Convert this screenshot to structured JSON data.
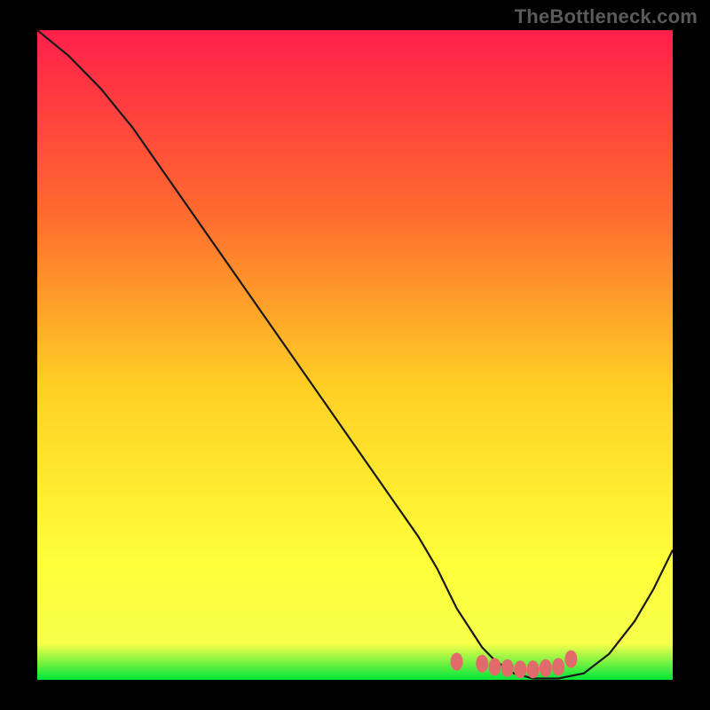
{
  "attribution": "TheBottleneck.com",
  "chart_data": {
    "type": "line",
    "title": "",
    "xlabel": "",
    "ylabel": "",
    "xlim": [
      0,
      100
    ],
    "ylim": [
      0,
      100
    ],
    "series": [
      {
        "name": "curve",
        "x": [
          0,
          5,
          10,
          15,
          20,
          25,
          30,
          35,
          40,
          45,
          50,
          55,
          60,
          63,
          66,
          70,
          72,
          75,
          78,
          82,
          86,
          90,
          94,
          97,
          100
        ],
        "y": [
          100,
          96,
          91,
          85,
          78,
          71,
          64,
          57,
          50,
          43,
          36,
          29,
          22,
          17,
          11,
          5,
          3,
          1,
          0.2,
          0.2,
          1,
          4,
          9,
          14,
          20
        ]
      },
      {
        "name": "markers",
        "x": [
          66,
          70,
          72,
          74,
          76,
          78,
          80,
          82,
          84
        ],
        "y": [
          2.8,
          2.5,
          2.0,
          1.8,
          1.6,
          1.6,
          1.8,
          2.0,
          3.2
        ]
      }
    ],
    "gradient": {
      "top": "#ff1f4b",
      "mid_upper": "#ff6a2f",
      "mid": "#ffd024",
      "mid_lower": "#ffff3a",
      "green_band_top": "#f6ff4a",
      "green_band_bottom": "#00e63a"
    },
    "green_band_fraction_from_bottom": 0.055,
    "marker_color": "#e26a6a",
    "curve_color": "#1a1a1a"
  }
}
